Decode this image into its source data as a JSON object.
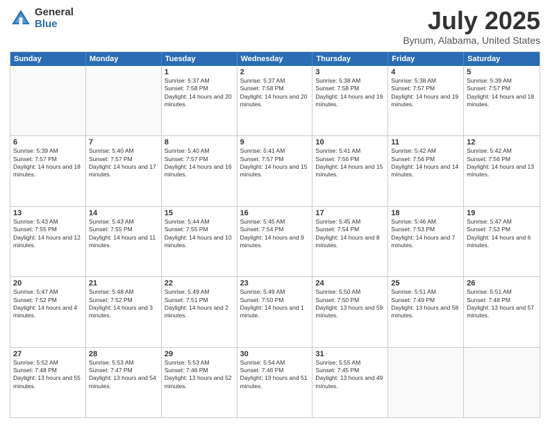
{
  "logo": {
    "general": "General",
    "blue": "Blue"
  },
  "title": {
    "month": "July 2025",
    "location": "Bynum, Alabama, United States"
  },
  "header_days": [
    "Sunday",
    "Monday",
    "Tuesday",
    "Wednesday",
    "Thursday",
    "Friday",
    "Saturday"
  ],
  "weeks": [
    [
      {
        "day": "",
        "empty": true
      },
      {
        "day": "",
        "empty": true
      },
      {
        "day": "1",
        "sunrise": "Sunrise: 5:37 AM",
        "sunset": "Sunset: 7:58 PM",
        "daylight": "Daylight: 14 hours and 20 minutes."
      },
      {
        "day": "2",
        "sunrise": "Sunrise: 5:37 AM",
        "sunset": "Sunset: 7:58 PM",
        "daylight": "Daylight: 14 hours and 20 minutes."
      },
      {
        "day": "3",
        "sunrise": "Sunrise: 5:38 AM",
        "sunset": "Sunset: 7:58 PM",
        "daylight": "Daylight: 14 hours and 19 minutes."
      },
      {
        "day": "4",
        "sunrise": "Sunrise: 5:38 AM",
        "sunset": "Sunset: 7:57 PM",
        "daylight": "Daylight: 14 hours and 19 minutes."
      },
      {
        "day": "5",
        "sunrise": "Sunrise: 5:39 AM",
        "sunset": "Sunset: 7:57 PM",
        "daylight": "Daylight: 14 hours and 18 minutes."
      }
    ],
    [
      {
        "day": "6",
        "sunrise": "Sunrise: 5:39 AM",
        "sunset": "Sunset: 7:57 PM",
        "daylight": "Daylight: 14 hours and 18 minutes."
      },
      {
        "day": "7",
        "sunrise": "Sunrise: 5:40 AM",
        "sunset": "Sunset: 7:57 PM",
        "daylight": "Daylight: 14 hours and 17 minutes."
      },
      {
        "day": "8",
        "sunrise": "Sunrise: 5:40 AM",
        "sunset": "Sunset: 7:57 PM",
        "daylight": "Daylight: 14 hours and 16 minutes."
      },
      {
        "day": "9",
        "sunrise": "Sunrise: 5:41 AM",
        "sunset": "Sunset: 7:57 PM",
        "daylight": "Daylight: 14 hours and 15 minutes."
      },
      {
        "day": "10",
        "sunrise": "Sunrise: 5:41 AM",
        "sunset": "Sunset: 7:56 PM",
        "daylight": "Daylight: 14 hours and 15 minutes."
      },
      {
        "day": "11",
        "sunrise": "Sunrise: 5:42 AM",
        "sunset": "Sunset: 7:56 PM",
        "daylight": "Daylight: 14 hours and 14 minutes."
      },
      {
        "day": "12",
        "sunrise": "Sunrise: 5:42 AM",
        "sunset": "Sunset: 7:56 PM",
        "daylight": "Daylight: 14 hours and 13 minutes."
      }
    ],
    [
      {
        "day": "13",
        "sunrise": "Sunrise: 5:43 AM",
        "sunset": "Sunset: 7:55 PM",
        "daylight": "Daylight: 14 hours and 12 minutes."
      },
      {
        "day": "14",
        "sunrise": "Sunrise: 5:43 AM",
        "sunset": "Sunset: 7:55 PM",
        "daylight": "Daylight: 14 hours and 11 minutes."
      },
      {
        "day": "15",
        "sunrise": "Sunrise: 5:44 AM",
        "sunset": "Sunset: 7:55 PM",
        "daylight": "Daylight: 14 hours and 10 minutes."
      },
      {
        "day": "16",
        "sunrise": "Sunrise: 5:45 AM",
        "sunset": "Sunset: 7:54 PM",
        "daylight": "Daylight: 14 hours and 9 minutes."
      },
      {
        "day": "17",
        "sunrise": "Sunrise: 5:45 AM",
        "sunset": "Sunset: 7:54 PM",
        "daylight": "Daylight: 14 hours and 8 minutes."
      },
      {
        "day": "18",
        "sunrise": "Sunrise: 5:46 AM",
        "sunset": "Sunset: 7:53 PM",
        "daylight": "Daylight: 14 hours and 7 minutes."
      },
      {
        "day": "19",
        "sunrise": "Sunrise: 5:47 AM",
        "sunset": "Sunset: 7:53 PM",
        "daylight": "Daylight: 14 hours and 6 minutes."
      }
    ],
    [
      {
        "day": "20",
        "sunrise": "Sunrise: 5:47 AM",
        "sunset": "Sunset: 7:52 PM",
        "daylight": "Daylight: 14 hours and 4 minutes."
      },
      {
        "day": "21",
        "sunrise": "Sunrise: 5:48 AM",
        "sunset": "Sunset: 7:52 PM",
        "daylight": "Daylight: 14 hours and 3 minutes."
      },
      {
        "day": "22",
        "sunrise": "Sunrise: 5:49 AM",
        "sunset": "Sunset: 7:51 PM",
        "daylight": "Daylight: 14 hours and 2 minutes."
      },
      {
        "day": "23",
        "sunrise": "Sunrise: 5:49 AM",
        "sunset": "Sunset: 7:50 PM",
        "daylight": "Daylight: 14 hours and 1 minute."
      },
      {
        "day": "24",
        "sunrise": "Sunrise: 5:50 AM",
        "sunset": "Sunset: 7:50 PM",
        "daylight": "Daylight: 13 hours and 59 minutes."
      },
      {
        "day": "25",
        "sunrise": "Sunrise: 5:51 AM",
        "sunset": "Sunset: 7:49 PM",
        "daylight": "Daylight: 13 hours and 58 minutes."
      },
      {
        "day": "26",
        "sunrise": "Sunrise: 5:51 AM",
        "sunset": "Sunset: 7:48 PM",
        "daylight": "Daylight: 13 hours and 57 minutes."
      }
    ],
    [
      {
        "day": "27",
        "sunrise": "Sunrise: 5:52 AM",
        "sunset": "Sunset: 7:48 PM",
        "daylight": "Daylight: 13 hours and 55 minutes."
      },
      {
        "day": "28",
        "sunrise": "Sunrise: 5:53 AM",
        "sunset": "Sunset: 7:47 PM",
        "daylight": "Daylight: 13 hours and 54 minutes."
      },
      {
        "day": "29",
        "sunrise": "Sunrise: 5:53 AM",
        "sunset": "Sunset: 7:46 PM",
        "daylight": "Daylight: 13 hours and 52 minutes."
      },
      {
        "day": "30",
        "sunrise": "Sunrise: 5:54 AM",
        "sunset": "Sunset: 7:46 PM",
        "daylight": "Daylight: 13 hours and 51 minutes."
      },
      {
        "day": "31",
        "sunrise": "Sunrise: 5:55 AM",
        "sunset": "Sunset: 7:45 PM",
        "daylight": "Daylight: 13 hours and 49 minutes."
      },
      {
        "day": "",
        "empty": true
      },
      {
        "day": "",
        "empty": true
      }
    ]
  ]
}
